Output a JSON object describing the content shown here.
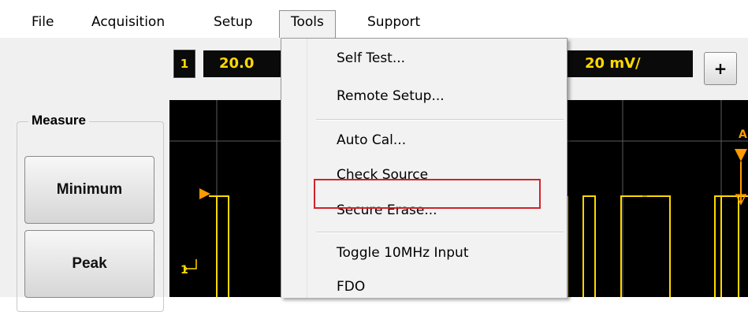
{
  "menubar": {
    "items": [
      "File",
      "Acquisition",
      "Setup",
      "Tools",
      "Support"
    ]
  },
  "toolbar": {
    "channel_number": "1",
    "timebase_readout": "20.0",
    "scale_readout": "20 mV/",
    "plus_label": "+"
  },
  "measure": {
    "title": "Measure",
    "buttons": [
      "Minimum",
      "Peak"
    ]
  },
  "scope": {
    "trigger_marker": "A",
    "channel_marker": "1"
  },
  "tools_menu": {
    "items": [
      "Self Test...",
      "Remote Setup...",
      "Auto Cal...",
      "Check Source",
      "Secure Erase...",
      "Toggle 10MHz Input",
      "FDO"
    ],
    "highlighted_item": "Check Source"
  },
  "colors": {
    "trace": "#ffd800",
    "marker": "#ff9a00",
    "grid": "#5a5a5a",
    "highlight": "#d0232a"
  }
}
